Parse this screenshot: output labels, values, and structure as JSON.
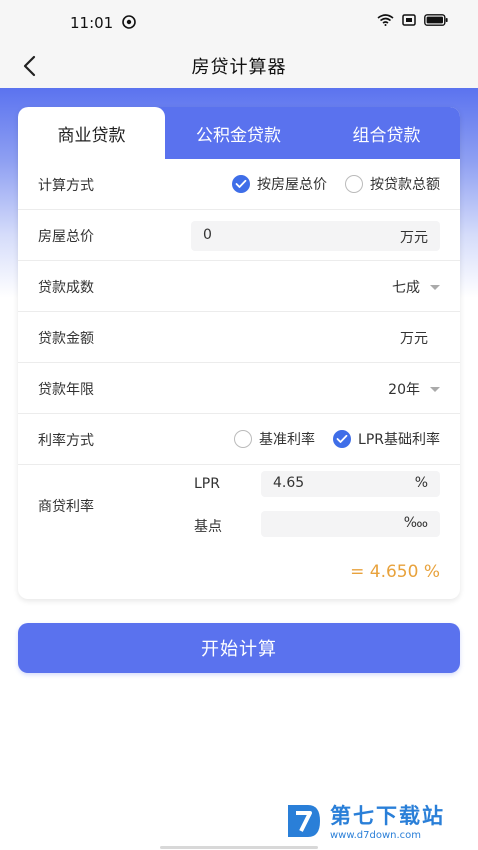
{
  "status_bar": {
    "time": "11:01"
  },
  "header": {
    "title": "房贷计算器",
    "back_icon": "chevron-left-icon"
  },
  "tabs": [
    {
      "label": "商业贷款",
      "active": true
    },
    {
      "label": "公积金贷款",
      "active": false
    },
    {
      "label": "组合贷款",
      "active": false
    }
  ],
  "form": {
    "calc_method": {
      "label": "计算方式",
      "options": [
        "按房屋总价",
        "按贷款总额"
      ],
      "selected": "按房屋总价"
    },
    "house_price": {
      "label": "房屋总价",
      "value": "0",
      "unit": "万元"
    },
    "loan_ratio": {
      "label": "贷款成数",
      "value": "七成"
    },
    "loan_amount": {
      "label": "贷款金额",
      "unit": "万元"
    },
    "loan_term": {
      "label": "贷款年限",
      "value": "20年"
    },
    "rate_method": {
      "label": "利率方式",
      "options": [
        "基准利率",
        "LPR基础利率"
      ],
      "selected": "LPR基础利率"
    },
    "commercial_rate": {
      "label": "商贷利率",
      "lpr_label": "LPR",
      "lpr_value": "4.65",
      "lpr_unit": "%",
      "bp_label": "基点",
      "bp_value": "",
      "bp_unit": "‱",
      "result": "= 4.650 %"
    }
  },
  "actions": {
    "calculate_label": "开始计算"
  },
  "watermark": {
    "name": "第七下载站",
    "url": "www.d7down.com"
  },
  "colors": {
    "primary": "#5a72ee",
    "check": "#3f6ee8",
    "result": "#e8a23c"
  }
}
